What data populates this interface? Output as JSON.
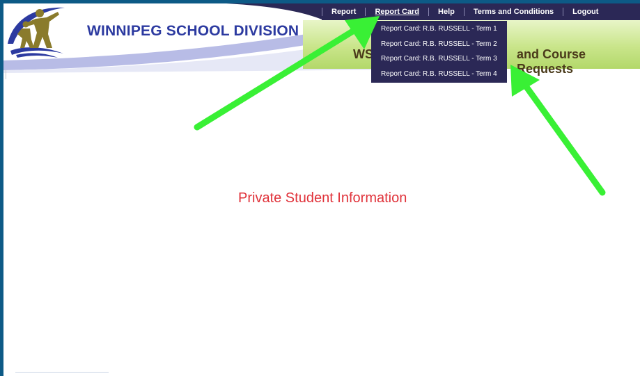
{
  "header": {
    "org_name": "WINNIPEG SCHOOL DIVISION",
    "band_title_left": "WS",
    "band_title_right": "and Course Requests"
  },
  "topnav": {
    "items": [
      {
        "label": "Report"
      },
      {
        "label": "Report Card",
        "active": true
      },
      {
        "label": "Help"
      },
      {
        "label": "Terms and Conditions"
      },
      {
        "label": "Logout"
      }
    ]
  },
  "dropdown": {
    "items": [
      {
        "label": "Report Card: R.B. RUSSELL - Term 1"
      },
      {
        "label": "Report Card: R.B. RUSSELL - Term 2"
      },
      {
        "label": "Report Card: R.B. RUSSELL - Term 3"
      },
      {
        "label": "Report Card: R.B. RUSSELL - Term 4"
      }
    ]
  },
  "main": {
    "private_notice": "Private Student Information"
  },
  "colors": {
    "nav_bg": "#2b2856",
    "org_name": "#2c3aa0",
    "notice": "#e0323a",
    "arrow": "#39f035",
    "frame_border": "#0d5a86"
  }
}
